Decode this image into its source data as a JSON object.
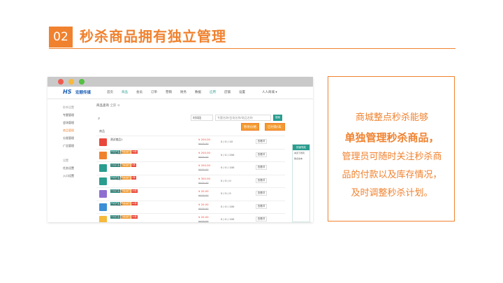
{
  "slide": {
    "number": "02",
    "title": "秒杀商品拥有独立管理",
    "accent_color": "#f0822f"
  },
  "app": {
    "logo": "HS",
    "logo_text": "宏顺传媒",
    "nav": [
      "首页",
      "商品",
      "会员",
      "订单",
      "营销",
      "财务",
      "数据",
      "应用",
      "店铺",
      "设置"
    ],
    "nav_active": "商品",
    "user": "人人商城 ▾"
  },
  "sidebar": {
    "group1_head": "秒杀设置",
    "group1": [
      "专题管理",
      "会场管理",
      "商品管理",
      "分类管理",
      "广告管理"
    ],
    "active": "商品管理",
    "group2_head": "设置",
    "group2": [
      "任务设置",
      "入口设置"
    ]
  },
  "main": {
    "breadcrumb": "商品查询",
    "breadcrumb_sub": "全部 ⊘",
    "search_icon": "search-icon",
    "select_value": "时间段",
    "search_placeholder": "专题名称/会场名称/商品名称",
    "search_button": "搜索",
    "btn_enable": "秒杀价格",
    "btn_status": "已付款/未付款/库存",
    "column_product": "商品",
    "rows": [
      {
        "name": "测试商品1",
        "tags": [
          "秒杀商品",
          "秒杀进行",
          "15件"
        ],
        "price": "¥ 200.00",
        "old": "¥400.00",
        "stock": "0 / 0 / 10",
        "detail": "查看详",
        "img_color": "#e9473b"
      },
      {
        "name": "测试商品2",
        "tags": [
          "秒杀商品",
          "秒杀进行",
          "5件"
        ],
        "price": "¥ 200.00",
        "old": "¥400.00",
        "stock": "0 / 0 / 200",
        "detail": "查看详",
        "img_color": "#f0822f"
      },
      {
        "name": "测试商品3",
        "tags": [
          "秒杀商品",
          "秒杀进行",
          "7件"
        ],
        "price": "¥ 200.00",
        "old": "¥400.00",
        "stock": "0 / 0 / 100",
        "detail": "查看详",
        "img_color": "#2a9d8f"
      },
      {
        "name": "测试商品4",
        "tags": [
          "秒杀商品",
          "秒杀进行",
          "20件"
        ],
        "price": "¥ 300.00",
        "old": "¥400.00",
        "stock": "0 / 0 / 0",
        "detail": "查看详",
        "img_color": "#2a9d8f"
      },
      {
        "name": "测试商品5",
        "tags": [
          "秒杀商品",
          "秒杀进行",
          "11件"
        ],
        "price": "¥ 20.00",
        "old": "¥400.00",
        "stock": "0 / 0 / 0",
        "detail": "查看详",
        "img_color": "#8e6fd1"
      },
      {
        "name": "测试商品6",
        "tags": [
          "秒杀商品",
          "秒杀进行",
          "11件"
        ],
        "price": "¥ 20.00",
        "old": "¥400.00",
        "stock": "0 / 0 / 100",
        "detail": "查看详",
        "img_color": "#3b8fd6"
      },
      {
        "name": "测试商品7",
        "tags": [
          "秒杀商品",
          "秒杀进行",
          "11件"
        ],
        "price": "¥ 20.00",
        "old": "¥400.00",
        "stock": "0 / 0 / 100",
        "detail": "查看详",
        "img_color": "#f6b93b"
      }
    ]
  },
  "quicknav": {
    "title": "快速导航",
    "items": [
      "本页下所有",
      "微点击本"
    ]
  },
  "textbox": {
    "line1": "商城整点秒杀能够",
    "line2": "单独管理秒杀商品，",
    "line3": "管理员可随时关注秒杀商",
    "line4": "品的付款以及库存情况，",
    "line5": "及时调整秒杀计划。"
  }
}
